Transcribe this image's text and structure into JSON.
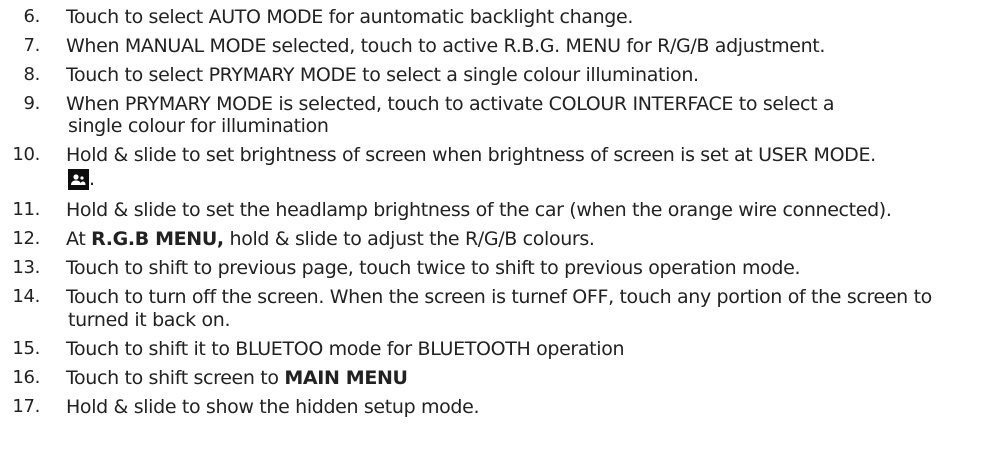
{
  "items": [
    {
      "number": "6.",
      "text": "Touch to select AUTO MODE for auntomatic backlight change."
    },
    {
      "number": "7.",
      "text": "When MANUAL MODE selected, touch to active R.B.G. MENU for R/G/B adjustment."
    },
    {
      "number": "8.",
      "text": "Touch to select PRYMARY MODE to select a single colour illumination."
    },
    {
      "number": "9.",
      "text_line1": "When PRYMARY MODE is selected, touch to activate COLOUR INTERFACE to select a",
      "text_line2": "single colour for illumination"
    },
    {
      "number": "10.",
      "text": "Hold & slide to set brightness of screen when brightness of screen is set at USER MODE.",
      "icon": "user-mode-icon",
      "icon_suffix": "."
    },
    {
      "number": "11.",
      "text": "Hold & slide to set the headlamp brightness of the car (when the orange wire connected)."
    },
    {
      "number": "12.",
      "prefix": "At ",
      "bold": "R.G.B MENU,",
      "suffix": " hold & slide to adjust the R/G/B colours."
    },
    {
      "number": "13.",
      "text": "Touch to shift to previous page, touch twice to shift to previous operation mode."
    },
    {
      "number": "14.",
      "text_line1": "Touch to turn off the screen. When the screen is turnef OFF, touch any portion of the screen to",
      "text_line2": "turned it back on."
    },
    {
      "number": "15.",
      "text": "Touch to shift it to BLUETOO mode for BLUETOOTH operation"
    },
    {
      "number": "16.",
      "prefix": "Touch to shift screen to ",
      "bold": "MAIN MENU"
    },
    {
      "number": "17.",
      "text": "Hold & slide to show the hidden setup mode."
    }
  ]
}
